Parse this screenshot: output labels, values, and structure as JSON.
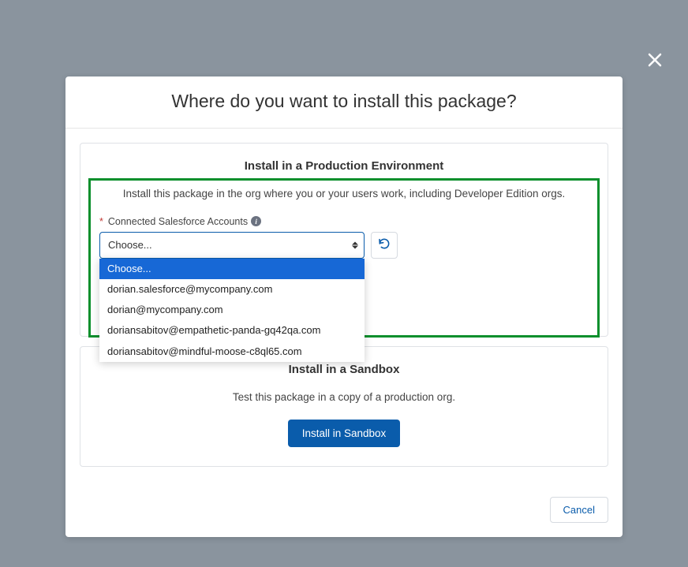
{
  "modal": {
    "title": "Where do you want to install this package?"
  },
  "production": {
    "title": "Install in a Production Environment",
    "desc": "Install this package in the org where you or your users work, including Developer Edition orgs.",
    "field_label": "Connected Salesforce Accounts",
    "required_mark": "*",
    "select_value": "Choose...",
    "options": [
      "Choose...",
      "dorian.salesforce@mycompany.com",
      "dorian@mycompany.com",
      "doriansabitov@empathetic-panda-gq42qa.com",
      "doriansabitov@mindful-moose-c8ql65.com"
    ]
  },
  "sandbox": {
    "title": "Install in a Sandbox",
    "desc": "Test this package in a copy of a production org.",
    "button": "Install in Sandbox"
  },
  "footer": {
    "cancel": "Cancel"
  }
}
